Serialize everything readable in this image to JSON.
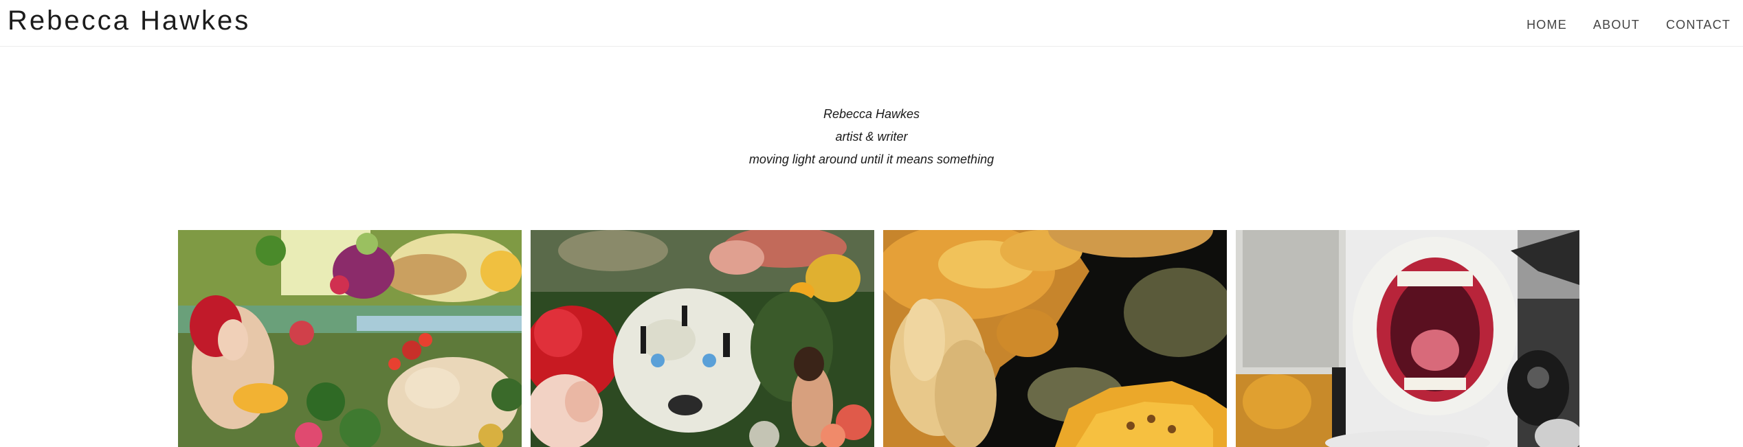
{
  "header": {
    "site_title": "Rebecca Hawkes",
    "nav": [
      {
        "label": "HOME"
      },
      {
        "label": "ABOUT"
      },
      {
        "label": "CONTACT"
      }
    ]
  },
  "intro": {
    "line1": "Rebecca Hawkes",
    "line2": "artist & writer",
    "line3": "moving light around until it means something"
  },
  "gallery": {
    "tiles": [
      {
        "icon": "painting-figures-garden"
      },
      {
        "icon": "painting-white-tiger"
      },
      {
        "icon": "painting-goldfish"
      },
      {
        "icon": "painting-open-mouth"
      }
    ]
  },
  "colors": {
    "text": "#1a1a1a",
    "nav_text": "#444444",
    "divider": "#ececec",
    "background": "#ffffff"
  }
}
